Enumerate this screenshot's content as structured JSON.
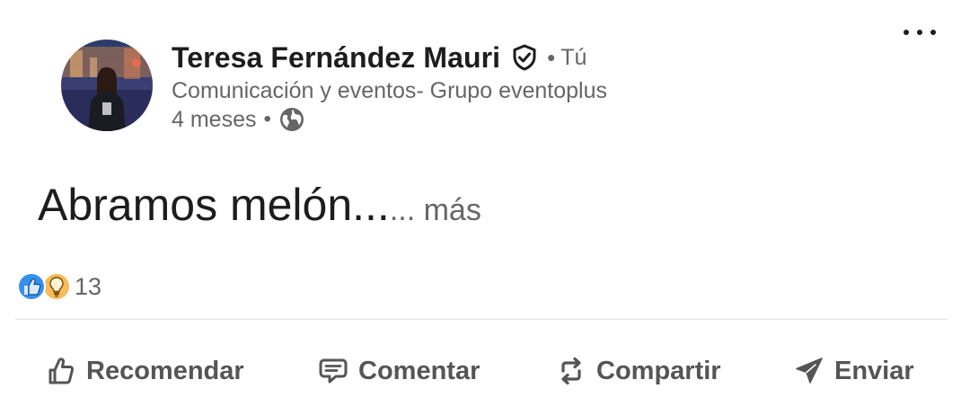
{
  "author": {
    "name": "Teresa Fernández Mauri",
    "you_label": "Tú",
    "headline": "Comunicación y eventos- Grupo eventoplus",
    "time": "4 meses",
    "separator": "•"
  },
  "post": {
    "text": "Abramos melón...",
    "see_more": "... más"
  },
  "reactions": {
    "icons": [
      "like-icon",
      "insightful-icon"
    ],
    "count": "13"
  },
  "actions": {
    "like": "Recomendar",
    "comment": "Comentar",
    "share": "Compartir",
    "send": "Enviar"
  },
  "colors": {
    "text_primary": "#1d1d1d",
    "text_secondary": "#666666",
    "like_blue": "#378fe9",
    "insightful_yellow": "#f5bb5c",
    "divider": "#e0e0e0"
  }
}
